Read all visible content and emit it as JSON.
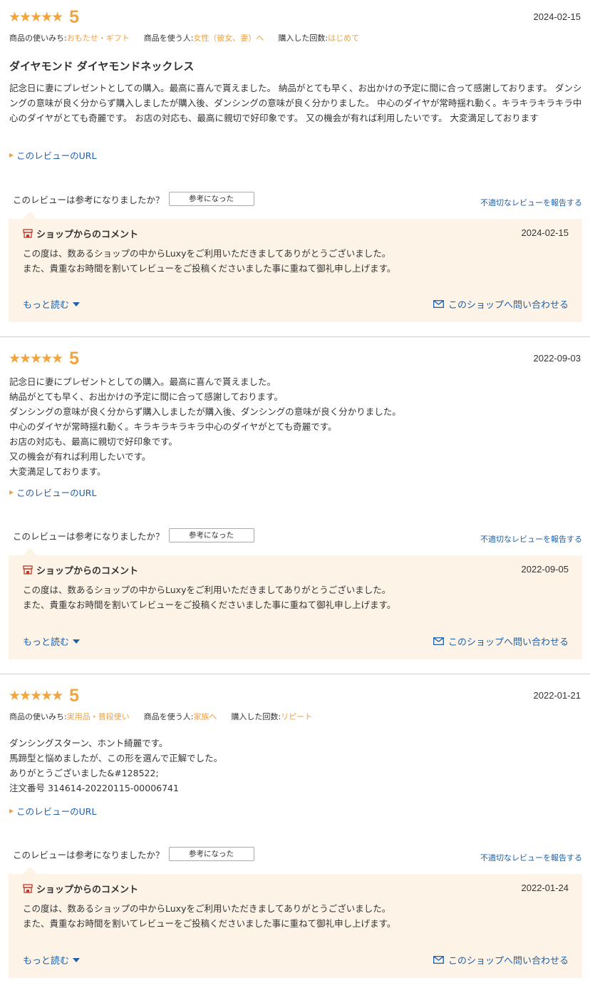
{
  "labels": {
    "usage": "商品の使いみち:",
    "user": "商品を使う人:",
    "count": "購入した回数:",
    "review_url": "このレビューのURL",
    "helpful_question": "このレビューは参考になりましたか？",
    "helpful_button": "参考になった",
    "report": "不適切なレビューを報告する",
    "shop_comment_title": "ショップからのコメント",
    "read_more": "もっと読む",
    "contact_shop": "このショップへ問い合わせる"
  },
  "colors": {
    "accent": "#f1a53c",
    "link": "#1e5faa",
    "comment_bg": "#fdf4e7"
  },
  "reviews": [
    {
      "stars": "★★★★★",
      "rating": "5",
      "date": "2024-02-15",
      "usage": "おもたせ・ギフト",
      "user": "女性（彼女、妻）へ",
      "count": "はじめて",
      "title": "ダイヤモンド ダイヤモンドネックレス",
      "body": "記念日に妻にプレゼントとしての購入。最高に喜んで貰えました。 納品がとても早く、お出かけの予定に間に合って感謝しております。 ダンシングの意味が良く分からず購入しましたが購入後、ダンシングの意味が良く分かりました。 中心のダイヤが常時揺れ動く。キラキラキラキラ中心のダイヤがとても奇麗です。 お店の対応も、最高に親切で好印象です。 又の機会が有れば利用したいです。 大変満足しております",
      "comment_date": "2024-02-15",
      "comment": "この度は、数あるショップの中からLuxyをご利用いただきましてありがとうございました。\nまた、貴重なお時間を割いてレビューをご投稿くださいました事に重ねて御礼申し上げます。"
    },
    {
      "stars": "★★★★★",
      "rating": "5",
      "date": "2022-09-03",
      "body": "記念日に妻にプレゼントとしての購入。最高に喜んで貰えました。\n納品がとても早く、お出かけの予定に間に合って感謝しております。\nダンシングの意味が良く分からず購入しましたが購入後、ダンシングの意味が良く分かりました。\n中心のダイヤが常時揺れ動く。キラキラキラキラ中心のダイヤがとても奇麗です。\nお店の対応も、最高に親切で好印象です。\n又の機会が有れば利用したいです。\n大変満足しております。",
      "comment_date": "2022-09-05",
      "comment": "この度は、数あるショップの中からLuxyをご利用いただきましてありがとうございました。\nまた、貴重なお時間を割いてレビューをご投稿くださいました事に重ねて御礼申し上げます。"
    },
    {
      "stars": "★★★★★",
      "rating": "5",
      "date": "2022-01-21",
      "usage": "実用品・普段使い",
      "user": "家族へ",
      "count": "リピート",
      "body": "ダンシングスターン、ホント綺麗です。\n馬蹄型と悩めましたが、この形を選んで正解でした。\nありがとうございました&#128522;\n注文番号 314614-20220115-00006741",
      "comment_date": "2022-01-24",
      "comment": "この度は、数あるショップの中からLuxyをご利用いただきましてありがとうございました。\nまた、貴重なお時間を割いてレビューをご投稿くださいました事に重ねて御礼申し上げます。"
    }
  ]
}
